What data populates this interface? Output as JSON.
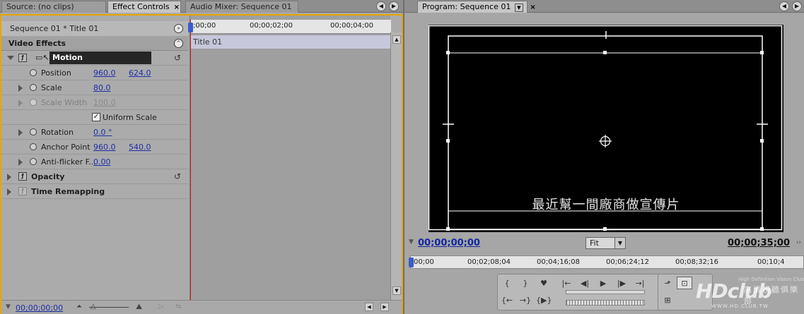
{
  "left_tabs": [
    {
      "label": "Source: (no clips)",
      "active": false
    },
    {
      "label": "Effect Controls",
      "active": true,
      "close": "×"
    },
    {
      "label": "Audio Mixer: Sequence 01",
      "active": false
    }
  ],
  "effect_controls": {
    "sequence_label": "Sequence 01 * Title 01",
    "section_header": "Video Effects",
    "motion": "Motion",
    "properties": {
      "position": {
        "label": "Position",
        "x": "960.0",
        "y": "624.0"
      },
      "scale": {
        "label": "Scale",
        "value": "80.0"
      },
      "scale_width": {
        "label": "Scale Width",
        "value": "100.0"
      },
      "uniform_scale": {
        "label": "Uniform Scale",
        "checked": true
      },
      "rotation": {
        "label": "Rotation",
        "value": "0.0 °"
      },
      "anchor_point": {
        "label": "Anchor Point",
        "x": "960.0",
        "y": "540.0"
      },
      "anti_flicker": {
        "label": "Anti-flicker F...",
        "value": "0.00"
      }
    },
    "opacity": "Opacity",
    "time_remapping": "Time Remapping",
    "timeline": {
      "ruler": [
        ";00;00",
        "00;00;02;00",
        "00;00;04;00"
      ],
      "clip": "Title 01"
    },
    "footer_timecode": "00;00;00;00"
  },
  "program": {
    "tab_label": "Program: Sequence 01",
    "tab_close": "×",
    "subtitle": "最近幫一間廠商做宣傳片",
    "current_timecode": "00;00;00;00",
    "duration_timecode": "00;00;35;00",
    "zoom": "Fit",
    "ruler": [
      "00;00",
      "00;02;08;04",
      "00;04;16;08",
      "00;06;24;12",
      "00;08;32;16",
      "00;10;4"
    ]
  },
  "watermark": {
    "logo": "HDclub",
    "tagline": "High Definition Vision Club",
    "cn": "高清視聽俱樂部",
    "url": "WWW.HD.CLUB.TW"
  }
}
